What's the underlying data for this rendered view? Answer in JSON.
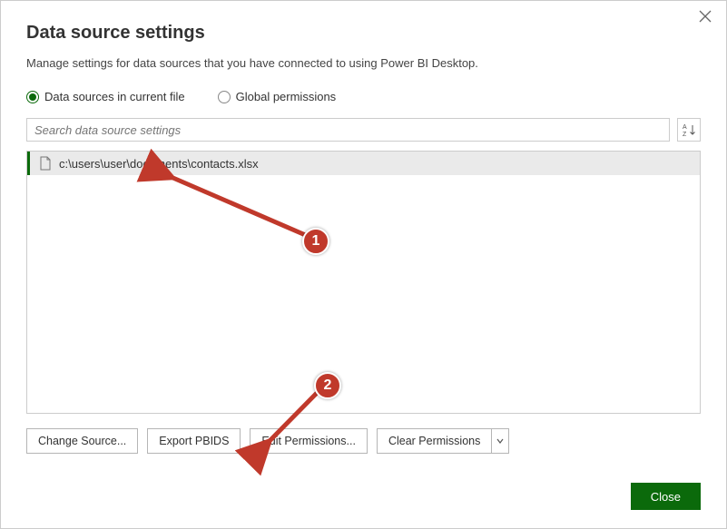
{
  "title": "Data source settings",
  "subtitle": "Manage settings for data sources that you have connected to using Power BI Desktop.",
  "radios": {
    "current": "Data sources in current file",
    "global": "Global permissions"
  },
  "search": {
    "placeholder": "Search data source settings"
  },
  "list": {
    "items": [
      {
        "path": "c:\\users\\user\\documents\\contacts.xlsx"
      }
    ]
  },
  "buttons": {
    "change_source": "Change Source...",
    "export_pbids": "Export PBIDS",
    "edit_permissions": "Edit Permissions...",
    "clear_permissions": "Clear Permissions",
    "close": "Close"
  },
  "annotations": {
    "one": "1",
    "two": "2"
  }
}
